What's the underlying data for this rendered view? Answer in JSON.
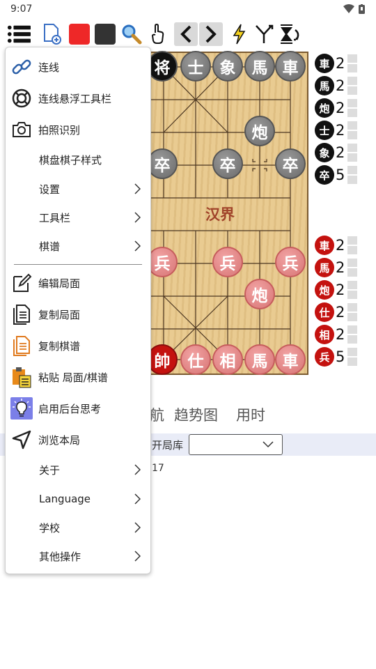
{
  "status": {
    "time": "9:07"
  },
  "toolbar": {
    "icons": [
      "menu-icon",
      "new-game-icon",
      "red-square-icon",
      "black-square-icon",
      "search-icon",
      "hand-icon",
      "back-icon",
      "forward-icon",
      "lightning-icon",
      "branch-icon",
      "flip-icon"
    ]
  },
  "board": {
    "river_text": "汉界",
    "black_pieces": [
      {
        "char": "将",
        "king": true
      },
      {
        "char": "士"
      },
      {
        "char": "象"
      },
      {
        "char": "馬"
      },
      {
        "char": "車"
      },
      {
        "char": "炮"
      },
      {
        "char": "卒"
      },
      {
        "char": "卒"
      },
      {
        "char": "卒"
      }
    ],
    "red_pieces": [
      {
        "char": "兵"
      },
      {
        "char": "兵"
      },
      {
        "char": "兵"
      },
      {
        "char": "炮"
      },
      {
        "char": "帥",
        "king": true
      },
      {
        "char": "仕"
      },
      {
        "char": "相"
      },
      {
        "char": "馬"
      },
      {
        "char": "車"
      }
    ]
  },
  "counts": {
    "black": [
      {
        "char": "車",
        "n": "2"
      },
      {
        "char": "馬",
        "n": "2"
      },
      {
        "char": "炮",
        "n": "2"
      },
      {
        "char": "士",
        "n": "2"
      },
      {
        "char": "象",
        "n": "2"
      },
      {
        "char": "卒",
        "n": "5"
      }
    ],
    "red": [
      {
        "char": "車",
        "n": "2"
      },
      {
        "char": "馬",
        "n": "2"
      },
      {
        "char": "炮",
        "n": "2"
      },
      {
        "char": "仕",
        "n": "2"
      },
      {
        "char": "相",
        "n": "2"
      },
      {
        "char": "兵",
        "n": "5"
      }
    ]
  },
  "tabs": {
    "partial": "航",
    "trend": "趋势图",
    "time": "用时"
  },
  "opening_book": {
    "label": "开局库",
    "value": ""
  },
  "info_text": "17",
  "menu": {
    "items": [
      {
        "label": "连线",
        "icon": "link-icon"
      },
      {
        "label": "连线悬浮工具栏",
        "icon": "lifebuoy-icon"
      },
      {
        "label": "拍照识别",
        "icon": "camera-icon"
      },
      {
        "label": "棋盘棋子样式"
      },
      {
        "label": "设置",
        "submenu": true
      },
      {
        "label": "工具栏",
        "submenu": true
      },
      {
        "label": "棋谱",
        "submenu": true
      },
      {
        "label": "编辑局面",
        "icon": "edit-icon"
      },
      {
        "label": "复制局面",
        "icon": "copy-position-icon"
      },
      {
        "label": "复制棋谱",
        "icon": "copy-record-icon"
      },
      {
        "label": "粘贴 局面/棋谱",
        "icon": "paste-icon"
      },
      {
        "label": "启用后台思考",
        "icon": "lightbulb-icon"
      },
      {
        "label": "浏览本局",
        "icon": "navigate-icon"
      },
      {
        "label": "关于",
        "submenu": true
      },
      {
        "label": "Language",
        "submenu": true
      },
      {
        "label": "学校",
        "submenu": true
      },
      {
        "label": "其他操作",
        "submenu": true
      }
    ]
  }
}
